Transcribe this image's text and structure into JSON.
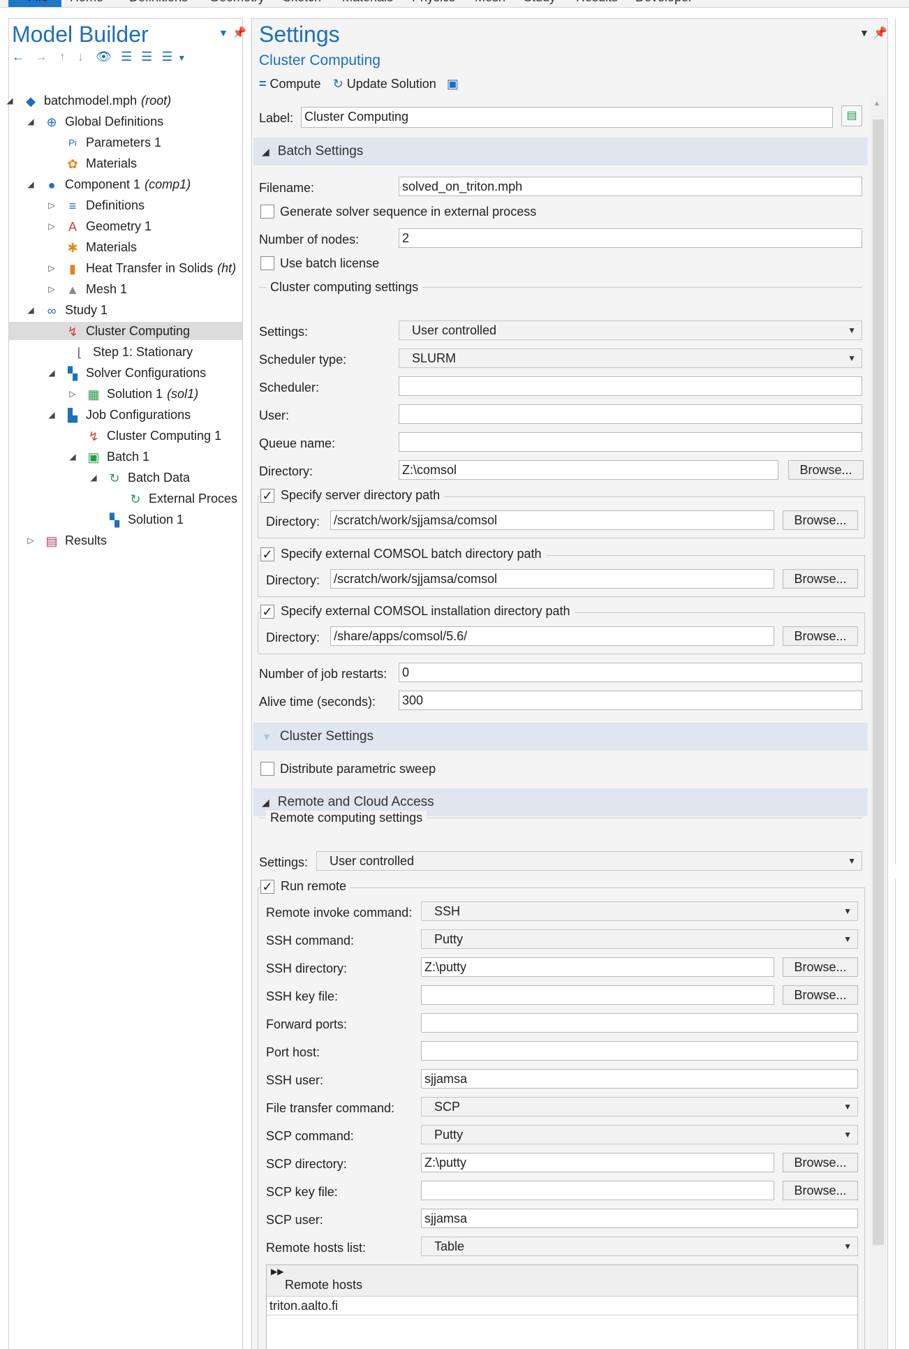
{
  "ribbon": {
    "tabs": [
      "File",
      "Home",
      "Definitions",
      "Geometry",
      "Sketch",
      "Materials",
      "Physics",
      "Mesh",
      "Study",
      "Results",
      "Developer"
    ]
  },
  "model_builder": {
    "title": "Model Builder",
    "tree": [
      {
        "label": "batchmodel.mph",
        "suffix": "(root)"
      },
      {
        "label": "Global Definitions",
        "suffix": ""
      },
      {
        "label": "Parameters 1",
        "suffix": ""
      },
      {
        "label": "Materials",
        "suffix": ""
      },
      {
        "label": "Component 1",
        "suffix": "(comp1)"
      },
      {
        "label": "Definitions",
        "suffix": ""
      },
      {
        "label": "Geometry 1",
        "suffix": ""
      },
      {
        "label": "Materials",
        "suffix": ""
      },
      {
        "label": "Heat Transfer in Solids",
        "suffix": "(ht)"
      },
      {
        "label": "Mesh 1",
        "suffix": ""
      },
      {
        "label": "Study 1",
        "suffix": ""
      },
      {
        "label": "Cluster Computing",
        "suffix": ""
      },
      {
        "label": "Step 1: Stationary",
        "suffix": ""
      },
      {
        "label": "Solver Configurations",
        "suffix": ""
      },
      {
        "label": "Solution 1",
        "suffix": "(sol1)"
      },
      {
        "label": "Job Configurations",
        "suffix": ""
      },
      {
        "label": "Cluster Computing 1",
        "suffix": ""
      },
      {
        "label": "Batch 1",
        "suffix": ""
      },
      {
        "label": "Batch Data",
        "suffix": ""
      },
      {
        "label": "External Proces",
        "suffix": ""
      },
      {
        "label": "Solution 1",
        "suffix": ""
      },
      {
        "label": "Results",
        "suffix": ""
      }
    ]
  },
  "settings": {
    "title": "Settings",
    "subtitle": "Cluster Computing",
    "toolbar": {
      "compute": "Compute",
      "update": "Update Solution"
    },
    "label_text": "Label:",
    "label_value": "Cluster Computing",
    "batch": {
      "header": "Batch Settings",
      "filename_label": "Filename:",
      "filename": "solved_on_triton.mph",
      "gen_seq": "Generate solver sequence in external process",
      "nodes_label": "Number of nodes:",
      "nodes": "2",
      "batch_license": "Use batch license",
      "group_title": "Cluster computing settings",
      "settings_label": "Settings:",
      "settings_value": "User controlled",
      "sched_type_label": "Scheduler type:",
      "sched_type": "SLURM",
      "scheduler_label": "Scheduler:",
      "scheduler": "",
      "user_label": "User:",
      "user": "",
      "queue_label": "Queue name:",
      "queue": "",
      "dir_label": "Directory:",
      "dir": "Z:\\comsol",
      "browse": "Browse...",
      "server_dir_title": "Specify server directory path",
      "server_dir": "/scratch/work/sjjamsa/comsol",
      "batch_dir_title": "Specify external COMSOL batch directory path",
      "batch_dir": "/scratch/work/sjjamsa/comsol",
      "install_dir_title": "Specify external COMSOL installation directory path",
      "install_dir": "/share/apps/comsol/5.6/",
      "restarts_label": "Number of job restarts:",
      "restarts": "0",
      "alive_label": "Alive time (seconds):",
      "alive": "300"
    },
    "cluster": {
      "header": "Cluster Settings",
      "distribute": "Distribute parametric sweep"
    },
    "remote": {
      "header": "Remote and Cloud Access",
      "group_title": "Remote computing settings",
      "settings_label": "Settings:",
      "settings_value": "User controlled",
      "run_remote": "Run remote",
      "invoke_label": "Remote invoke command:",
      "invoke": "SSH",
      "ssh_cmd_label": "SSH command:",
      "ssh_cmd": "Putty",
      "ssh_dir_label": "SSH directory:",
      "ssh_dir": "Z:\\putty",
      "ssh_key_label": "SSH key file:",
      "ssh_key": "",
      "fwd_label": "Forward ports:",
      "fwd": "",
      "port_host_label": "Port host:",
      "port_host": "",
      "ssh_user_label": "SSH user:",
      "ssh_user": "sjjamsa",
      "ft_label": "File transfer command:",
      "ft": "SCP",
      "scp_cmd_label": "SCP command:",
      "scp_cmd": "Putty",
      "scp_dir_label": "SCP directory:",
      "scp_dir": "Z:\\putty",
      "scp_key_label": "SCP key file:",
      "scp_key": "",
      "scp_user_label": "SCP user:",
      "scp_user": "sjjamsa",
      "hosts_list_label": "Remote hosts list:",
      "hosts_list": "Table",
      "hosts_header": "Remote hosts",
      "hosts": [
        "triton.aalto.fi"
      ]
    }
  },
  "colors": {
    "accent": "#1d6fba",
    "section_bg": "#dfe6f0",
    "selected": "#dcdcdc"
  }
}
